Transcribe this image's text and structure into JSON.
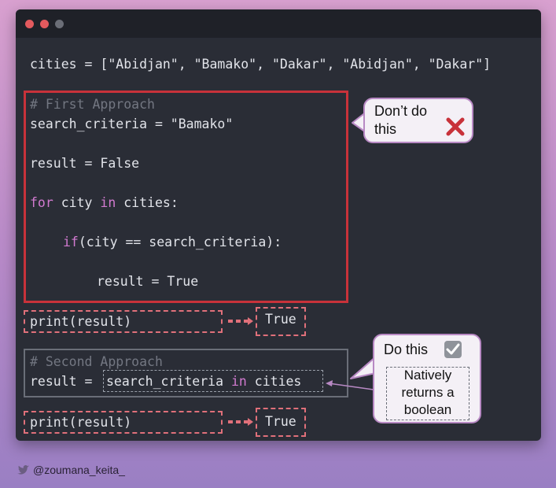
{
  "window": {
    "traffic_lights": [
      "#e35a5e",
      "#e35a5e",
      "#6b6e77"
    ]
  },
  "code": {
    "line_cities": "cities = [\"Abidjan\", \"Bamako\", \"Dakar\", \"Abidjan\", \"Dakar\"]",
    "first_comment": "# First Approach",
    "first_criteria": "search_criteria = \"Bamako\"",
    "first_result_init": "result = False",
    "for_kw": "for",
    "for_var": " city ",
    "in_kw": "in",
    "for_rest": " cities:",
    "if_kw": "if",
    "if_rest": "(city == search_criteria):",
    "assign_true": "result = True",
    "print1": "print(result)",
    "output1": "True",
    "second_comment": "# Second Approach",
    "second_prefix": "result = ",
    "second_expr_a": "search_criteria ",
    "second_expr_in": "in",
    "second_expr_b": " cities",
    "print2": "print(result)",
    "output2": "True"
  },
  "callouts": {
    "dont": {
      "text_line1": "Don’t do",
      "text_line2": "this",
      "icon": "red-x-icon"
    },
    "do": {
      "text": "Do this",
      "icon": "checkmark-box-icon"
    },
    "note": {
      "line1": "Natively",
      "line2": "returns a",
      "line3": "boolean"
    }
  },
  "footer": {
    "handle": "@zoumana_keita_"
  },
  "colors": {
    "keyword": "#d27ad0",
    "comment": "#737782",
    "red": "#c8323a",
    "window_bg": "#2a2d36"
  }
}
